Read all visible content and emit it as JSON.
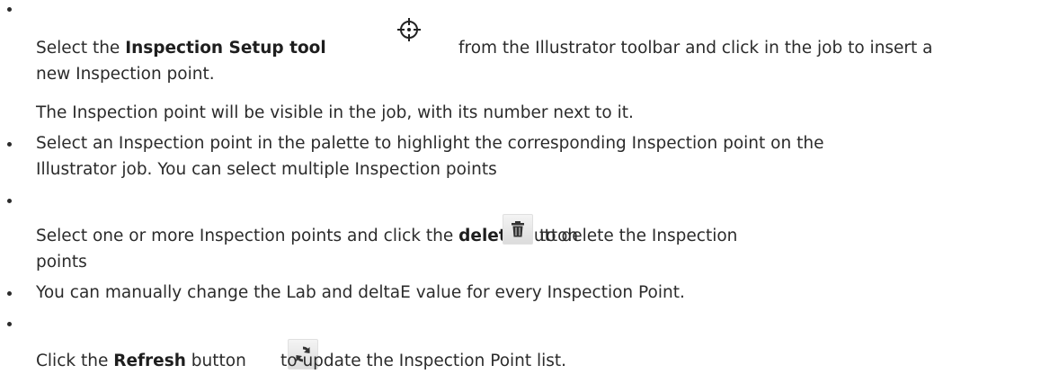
{
  "steps": [
    {
      "pre": "Select the ",
      "bold": "Inspection Setup tool",
      "icon": "crosshair-target-icon",
      "post": "from the Illustrator toolbar and click in the job to insert a",
      "cont": "new Inspection point."
    },
    {
      "note": "The Inspection point will be visible in the job, with its number next to it."
    },
    {
      "line1": "Select an Inspection point in the palette to highlight the corresponding Inspection point on the",
      "line2": "Illustrator job. You can select multiple Inspection points"
    },
    {
      "pre": "Select one or more Inspection points and click the ",
      "bold": "delete",
      "mid": " button",
      "icon": "trash-icon",
      "post": "to delete the Inspection",
      "cont": "points"
    },
    {
      "text": "You can manually change the Lab and deltaE value for every Inspection Point."
    },
    {
      "pre": "Click the ",
      "bold": "Refresh",
      "mid": " button",
      "icon": "refresh-icon",
      "post": "to update the Inspection Point list."
    }
  ]
}
